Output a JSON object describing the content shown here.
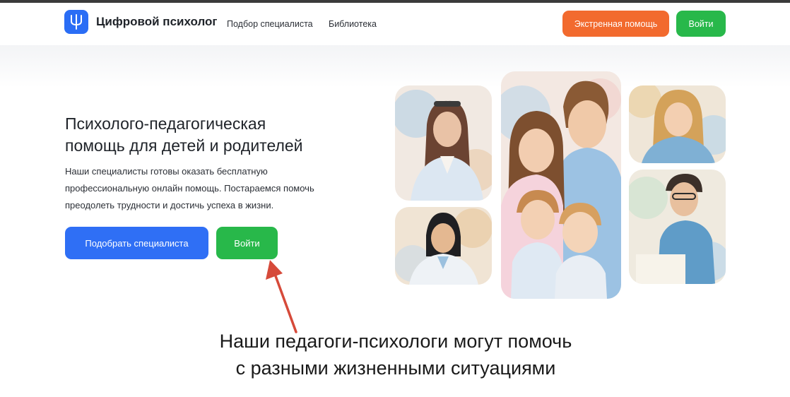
{
  "header": {
    "brand": "Цифровой психолог",
    "nav": [
      "Подбор специалиста",
      "Библиотека"
    ],
    "emergency_label": "Экстренная помощь",
    "login_label": "Войти"
  },
  "hero": {
    "title_line1": "Психолого-педагогическая",
    "title_line2": "помощь для детей и родителей",
    "text_line1": "Наши специалисты готовы оказать бесплатную",
    "text_line2": "профессиональную онлайн помощь. Постараемся помочь",
    "text_line3": "преодолеть трудности и достичь успеха в жизни.",
    "find_label": "Подобрать специалиста",
    "login_label": "Войти"
  },
  "caption": {
    "line1": "Наши педагоги-психологи могут помочь",
    "line2": "с разными жизненными ситуациями"
  },
  "colors": {
    "brand_blue": "#2a6df5",
    "primary_blue": "#2f6ff5",
    "green": "#28b84a",
    "orange": "#f26a2e",
    "annotation_red": "#d64a3a"
  },
  "icons": {
    "logo": "psi-logo-icon",
    "arrow": "annotation-arrow"
  }
}
